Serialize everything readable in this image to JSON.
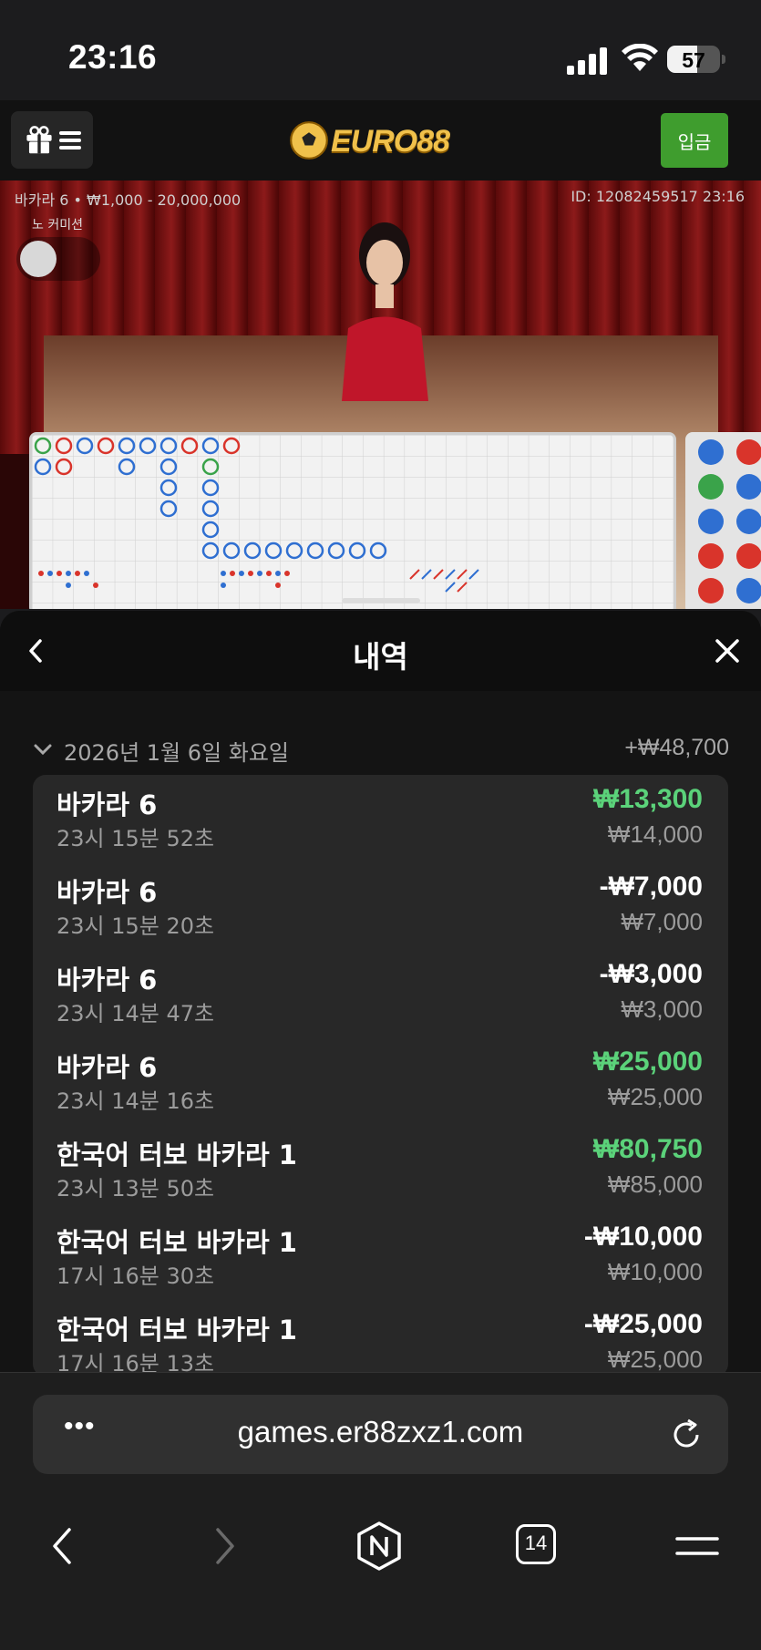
{
  "status_bar": {
    "time": "23:16",
    "battery_percent": "57",
    "battery_level": 0.57
  },
  "site": {
    "logo_text": "EURO88",
    "deposit_label": "입금"
  },
  "game": {
    "table_info": "바카라 6 • ₩1,000 - 20,000,000",
    "game_id": "ID: 12082459517 23:16",
    "no_commission_label": "노 커미션"
  },
  "sheet": {
    "title": "내역",
    "day": {
      "date": "2026년 1월 6일 화요일",
      "total": "+₩48,700"
    },
    "items": [
      {
        "name": "바카라 6",
        "time": "23시 15분 52초",
        "result": "₩13,300",
        "stake": "₩14,000",
        "win": true
      },
      {
        "name": "바카라 6",
        "time": "23시 15분 20초",
        "result": "-₩7,000",
        "stake": "₩7,000",
        "win": false
      },
      {
        "name": "바카라 6",
        "time": "23시 14분 47초",
        "result": "-₩3,000",
        "stake": "₩3,000",
        "win": false
      },
      {
        "name": "바카라 6",
        "time": "23시 14분 16초",
        "result": "₩25,000",
        "stake": "₩25,000",
        "win": true
      },
      {
        "name": "한국어 터보 바카라 1",
        "time": "23시 13분 50초",
        "result": "₩80,750",
        "stake": "₩85,000",
        "win": true
      },
      {
        "name": "한국어 터보 바카라 1",
        "time": "17시 16분 30초",
        "result": "-₩10,000",
        "stake": "₩10,000",
        "win": false
      },
      {
        "name": "한국어 터보 바카라 1",
        "time": "17시 16분 13초",
        "result": "-₩25,000",
        "stake": "₩25,000",
        "win": false
      }
    ]
  },
  "browser": {
    "url": "games.er88zxz1.com",
    "tab_count": "14"
  },
  "colors": {
    "win": "#5bd27a",
    "loss": "#ffffff",
    "deposit": "#3f9d2e",
    "player": "#2f6fd1",
    "banker": "#d9342b"
  }
}
